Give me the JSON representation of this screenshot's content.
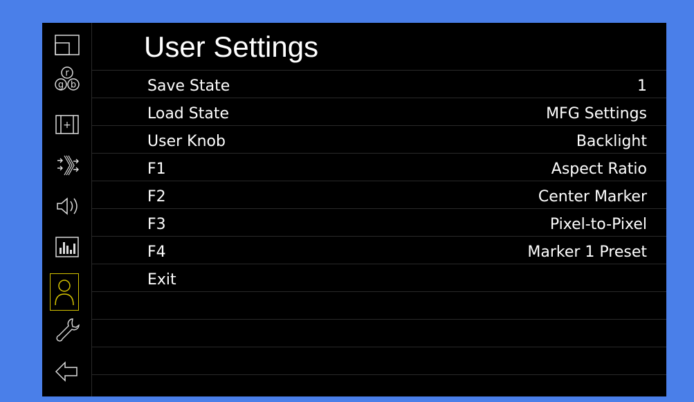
{
  "page": {
    "title": "User Settings"
  },
  "sidebar": {
    "items": [
      {
        "name": "display-icon"
      },
      {
        "name": "rgb-icon",
        "glyph_r": "r",
        "glyph_g": "g",
        "glyph_b": "b"
      },
      {
        "name": "marker-icon",
        "glyph": "+"
      },
      {
        "name": "input-icon"
      },
      {
        "name": "audio-icon"
      },
      {
        "name": "analysis-icon"
      },
      {
        "name": "user-icon",
        "active": true
      },
      {
        "name": "wrench-icon"
      },
      {
        "name": "back-arrow-icon"
      }
    ],
    "active_color": "#d6c400"
  },
  "menu": {
    "rows": [
      {
        "label": "Save State",
        "value": "1"
      },
      {
        "label": "Load State",
        "value": "MFG Settings"
      },
      {
        "label": "User Knob",
        "value": "Backlight"
      },
      {
        "label": "F1",
        "value": "Aspect Ratio"
      },
      {
        "label": "F2",
        "value": "Center Marker"
      },
      {
        "label": "F3",
        "value": "Pixel-to-Pixel"
      },
      {
        "label": "F4",
        "value": "Marker 1 Preset"
      },
      {
        "label": "Exit",
        "value": ""
      }
    ]
  },
  "colors": {
    "background": "#4a7fe9",
    "panel": "#000000",
    "text": "#ffffff",
    "divider": "#2a2a2a"
  }
}
